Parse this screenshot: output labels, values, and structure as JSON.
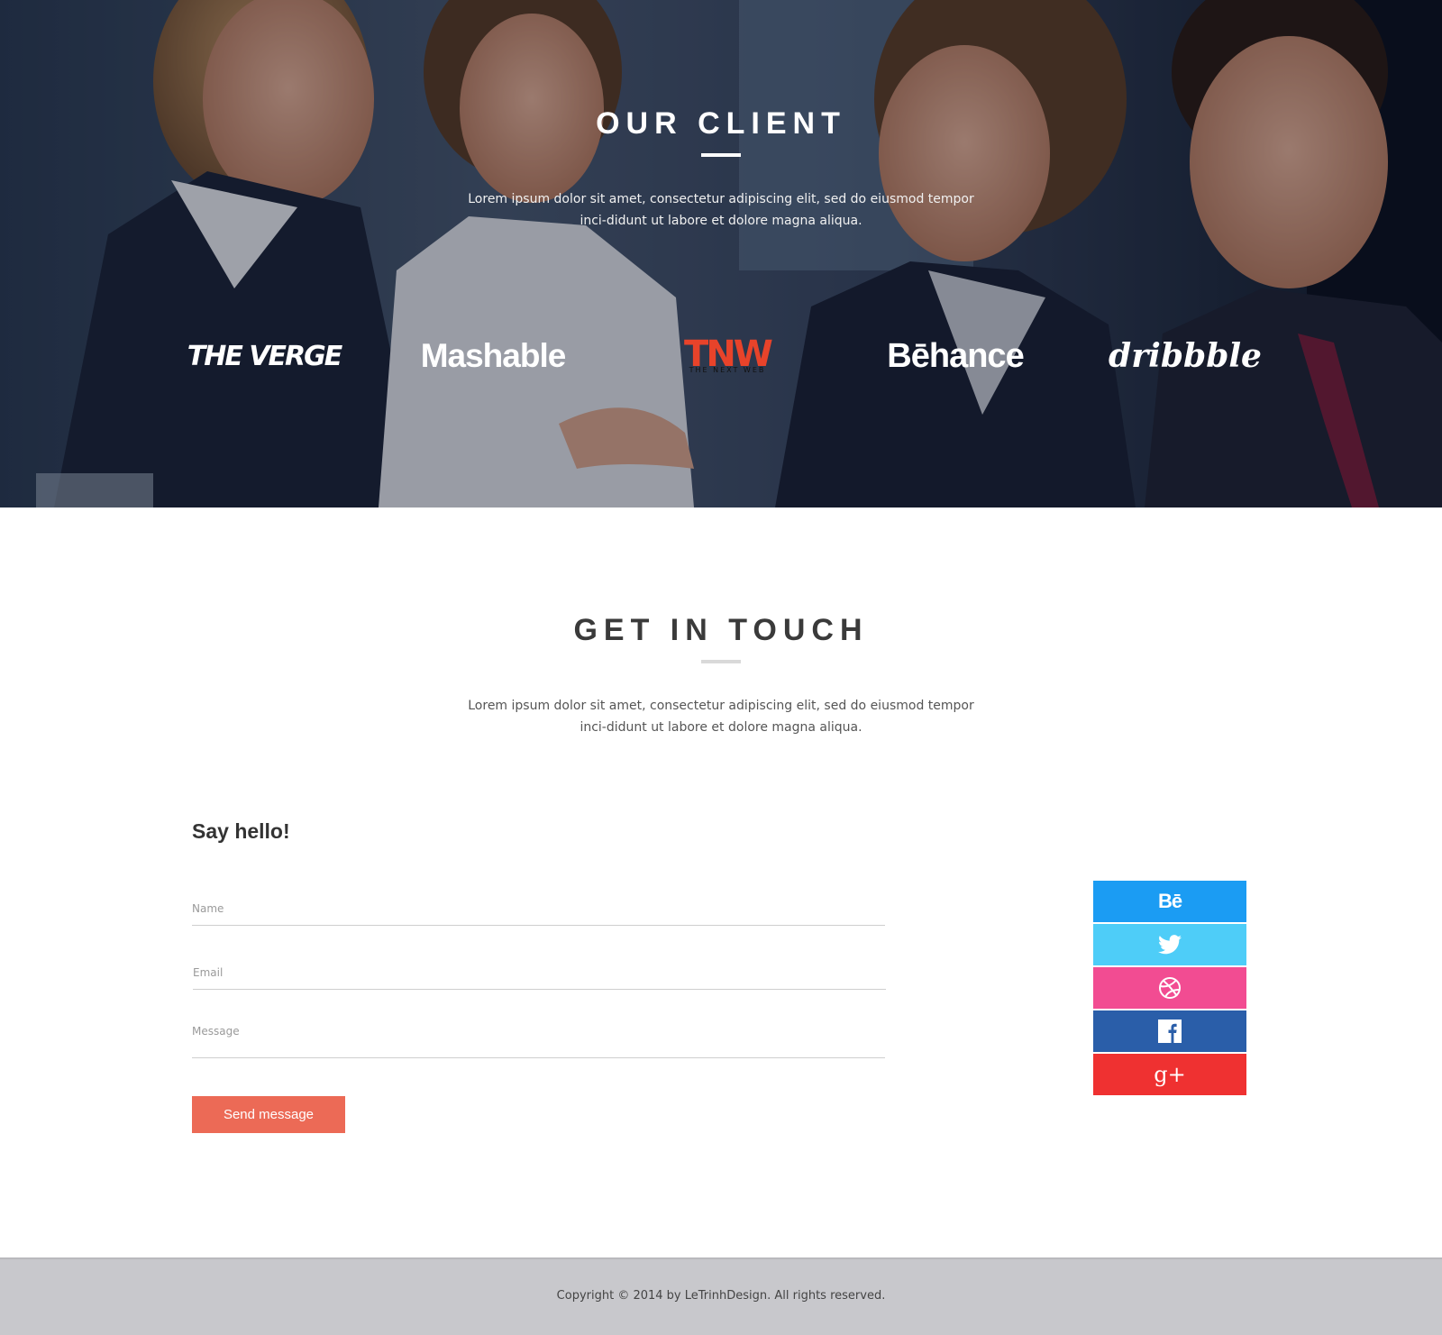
{
  "clients": {
    "title": "OUR CLIENT",
    "description": "Lorem ipsum dolor sit amet, consectetur adipiscing elit, sed do eiusmod tempor inci-didunt ut labore et dolore magna aliqua.",
    "logos": {
      "verge": "THE VERGE",
      "mashable": "Mashable",
      "tnw": "TNW",
      "tnw_sub": "THE NEXT WEB",
      "behance": "Bēhance",
      "dribbble": "dribbble"
    }
  },
  "contact": {
    "title": "GET IN TOUCH",
    "description": "Lorem ipsum dolor sit amet, consectetur adipiscing elit, sed do eiusmod tempor inci-didunt ut labore et dolore magna aliqua.",
    "form_heading": "Say hello!",
    "fields": {
      "name_placeholder": "Name",
      "email_placeholder": "Email",
      "message_placeholder": "Message"
    },
    "send_label": "Send message"
  },
  "social": [
    {
      "name": "behance-icon",
      "label": "Bē",
      "color": "#1b9cf3"
    },
    {
      "name": "twitter-icon",
      "color": "#4ecdf8"
    },
    {
      "name": "dribbble-icon",
      "color": "#f24c92"
    },
    {
      "name": "facebook-icon",
      "color": "#2a5ea9"
    },
    {
      "name": "google-plus-icon",
      "label": "g+",
      "color": "#ef3131"
    }
  ],
  "colors": {
    "accent": "#ec6a56",
    "footer_bg": "#c8c8cc"
  },
  "footer": {
    "copyright": "Copyright © 2014 by LeTrinhDesign.  All rights reserved."
  }
}
